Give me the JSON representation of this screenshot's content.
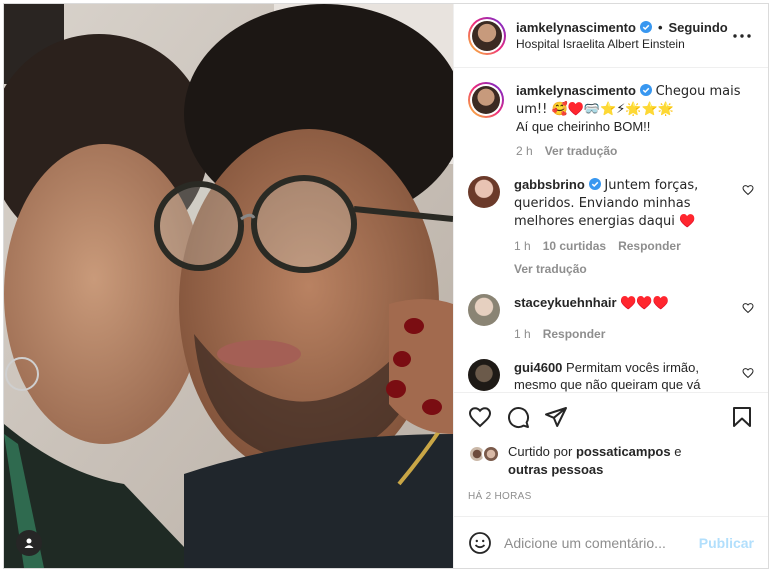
{
  "post": {
    "username": "iamkelynascimento",
    "follow_status": "Seguindo",
    "separator": "•",
    "location": "Hospital Israelita Albert Einstein",
    "more_icon": "more-options-icon"
  },
  "caption": {
    "username": "iamkelynascimento",
    "text_line1": "Chegou mais um!! 🥰♥️🥽⭐⚡🌟⭐🌟",
    "text_line2": "Aí que cheirinho BOM!!",
    "time": "2 h",
    "translate": "Ver tradução"
  },
  "comments": [
    {
      "username": "gabbsbrino",
      "text": "Juntem forças, queridos. Enviando minhas melhores energias daqui ♥️",
      "time": "1 h",
      "likes": "10 curtidas",
      "reply": "Responder",
      "translate": "Ver tradução"
    },
    {
      "username": "staceykuehnhair",
      "text": "♥️♥️♥️",
      "time": "1 h",
      "reply": "Responder"
    },
    {
      "username": "gui4600",
      "text": "Permitam vocês irmão, mesmo que não queiram que vá"
    }
  ],
  "liked_by": {
    "prefix": "Curtido por",
    "user": "possaticampos",
    "conj": "e",
    "others": "outras pessoas"
  },
  "posted_ago": "HÁ 2 HORAS",
  "add_comment": {
    "placeholder": "Adicione um comentário...",
    "publish": "Publicar"
  },
  "colors": {
    "verified": "#3897f0",
    "heart_red": "#ed4956",
    "muted": "#8e8e8e",
    "publish_disabled": "#b2dffc"
  }
}
